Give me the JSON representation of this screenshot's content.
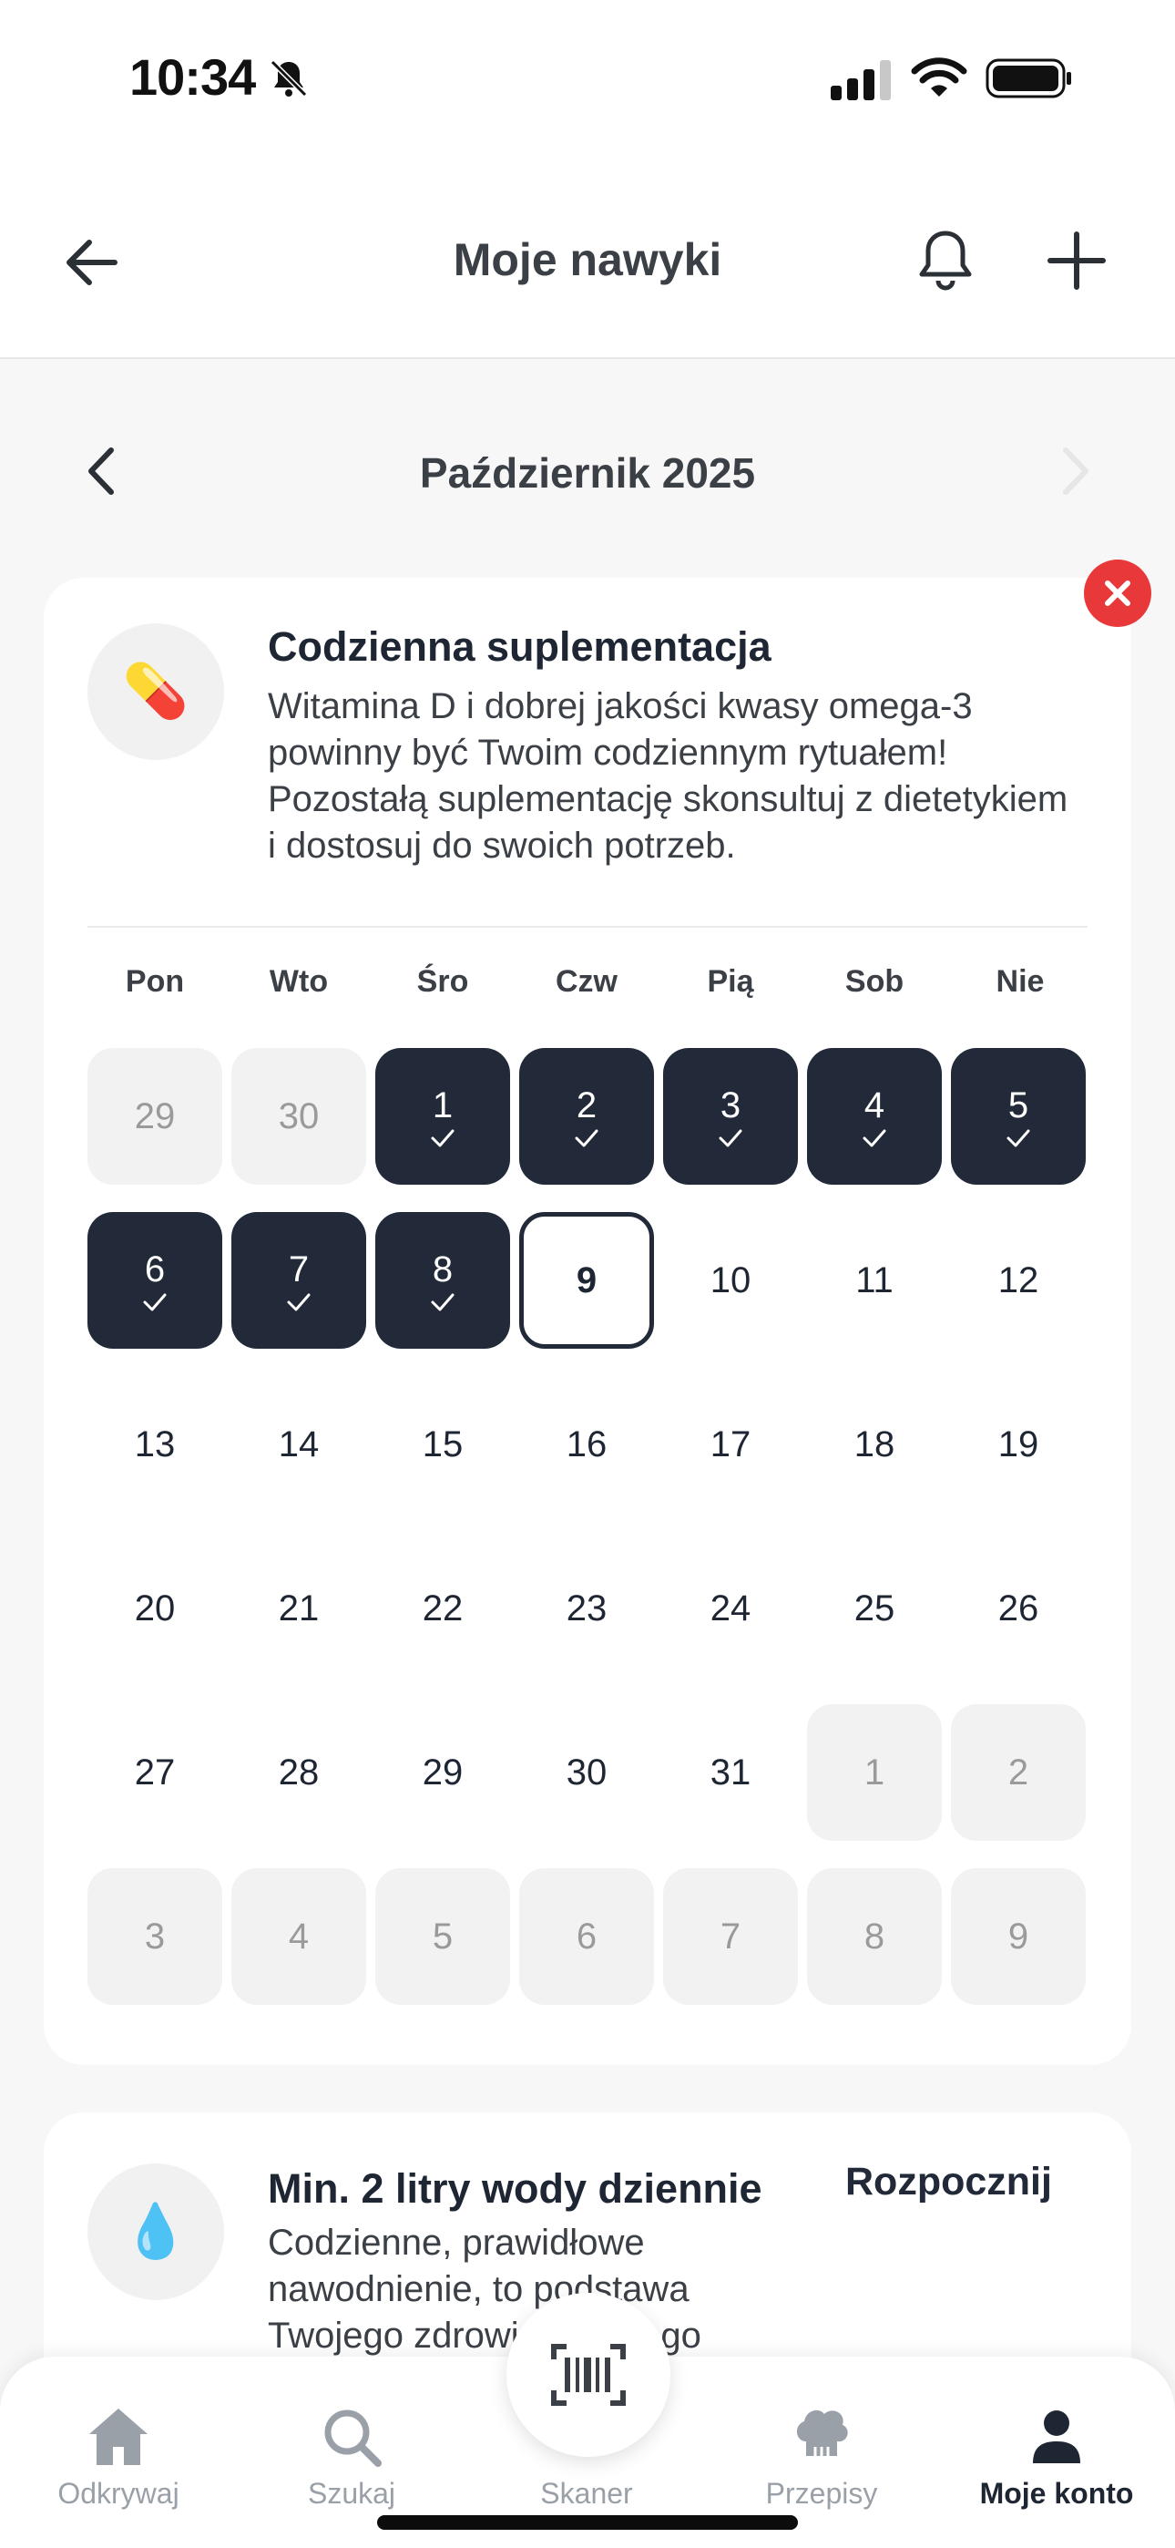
{
  "status": {
    "time": "10:34"
  },
  "header": {
    "title": "Moje nawyki"
  },
  "month": {
    "label": "Październik 2025"
  },
  "habit1": {
    "icon": "pill-icon",
    "icon_glyph": "💊",
    "title": "Codzienna suplementacja",
    "description": "Witamina D i dobrej jakości kwasy omega-3 powinny być Twoim codziennym rytuałem! Pozostałą suplementację skonsultuj z dietetykiem i dostosuj do swoich potrzeb."
  },
  "weekdays": [
    "Pon",
    "Wto",
    "Śro",
    "Czw",
    "Pią",
    "Sob",
    "Nie"
  ],
  "calendar": {
    "weeks": [
      [
        {
          "d": "29",
          "s": "outside"
        },
        {
          "d": "30",
          "s": "outside"
        },
        {
          "d": "1",
          "s": "done"
        },
        {
          "d": "2",
          "s": "done"
        },
        {
          "d": "3",
          "s": "done"
        },
        {
          "d": "4",
          "s": "done"
        },
        {
          "d": "5",
          "s": "done"
        }
      ],
      [
        {
          "d": "6",
          "s": "done"
        },
        {
          "d": "7",
          "s": "done"
        },
        {
          "d": "8",
          "s": "done"
        },
        {
          "d": "9",
          "s": "today"
        },
        {
          "d": "10",
          "s": "normal"
        },
        {
          "d": "11",
          "s": "normal"
        },
        {
          "d": "12",
          "s": "normal"
        }
      ],
      [
        {
          "d": "13",
          "s": "normal"
        },
        {
          "d": "14",
          "s": "normal"
        },
        {
          "d": "15",
          "s": "normal"
        },
        {
          "d": "16",
          "s": "normal"
        },
        {
          "d": "17",
          "s": "normal"
        },
        {
          "d": "18",
          "s": "normal"
        },
        {
          "d": "19",
          "s": "normal"
        }
      ],
      [
        {
          "d": "20",
          "s": "normal"
        },
        {
          "d": "21",
          "s": "normal"
        },
        {
          "d": "22",
          "s": "normal"
        },
        {
          "d": "23",
          "s": "normal"
        },
        {
          "d": "24",
          "s": "normal"
        },
        {
          "d": "25",
          "s": "normal"
        },
        {
          "d": "26",
          "s": "normal"
        }
      ],
      [
        {
          "d": "27",
          "s": "normal"
        },
        {
          "d": "28",
          "s": "normal"
        },
        {
          "d": "29",
          "s": "normal"
        },
        {
          "d": "30",
          "s": "normal"
        },
        {
          "d": "31",
          "s": "normal"
        },
        {
          "d": "1",
          "s": "outside"
        },
        {
          "d": "2",
          "s": "outside"
        }
      ],
      [
        {
          "d": "3",
          "s": "outside"
        },
        {
          "d": "4",
          "s": "outside"
        },
        {
          "d": "5",
          "s": "outside"
        },
        {
          "d": "6",
          "s": "outside"
        },
        {
          "d": "7",
          "s": "outside"
        },
        {
          "d": "8",
          "s": "outside"
        },
        {
          "d": "9",
          "s": "outside"
        }
      ]
    ]
  },
  "habit2": {
    "icon": "water-drop-icon",
    "icon_glyph": "💧",
    "title": "Min. 2 litry wody dziennie",
    "start_label": "Rozpocznij",
    "description": "Codzienne, prawidłowe nawodnienie, to podstawa Twojego zdrowia i dobrego samopoczucia."
  },
  "tabs": [
    {
      "label": "Odkrywaj",
      "icon": "home-icon"
    },
    {
      "label": "Szukaj",
      "icon": "search-icon"
    },
    {
      "label": "Skaner",
      "icon": "barcode-icon"
    },
    {
      "label": "Przepisy",
      "icon": "chef-hat-icon"
    },
    {
      "label": "Moje konto",
      "icon": "user-icon"
    }
  ],
  "colors": {
    "accent": "#222a3a",
    "remove": "#e8383a",
    "background": "#f7f7f7"
  }
}
